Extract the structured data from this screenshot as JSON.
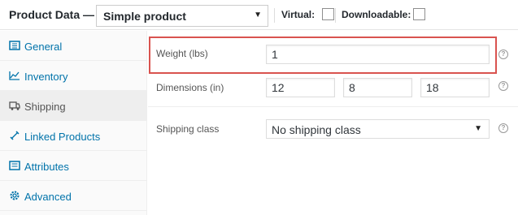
{
  "header": {
    "title": "Product Data —",
    "product_type": "Simple product",
    "virtual_label": "Virtual:",
    "downloadable_label": "Downloadable:"
  },
  "sidebar": {
    "items": [
      {
        "label": "General",
        "icon": "general-grid-icon"
      },
      {
        "label": "Inventory",
        "icon": "inventory-chart-icon"
      },
      {
        "label": "Shipping",
        "icon": "shipping-truck-icon",
        "active": true
      },
      {
        "label": "Linked Products",
        "icon": "link-icon"
      },
      {
        "label": "Attributes",
        "icon": "attributes-list-icon"
      },
      {
        "label": "Advanced",
        "icon": "gear-icon"
      }
    ]
  },
  "shipping": {
    "weight_label": "Weight (lbs)",
    "weight_value": "1",
    "dimensions_label": "Dimensions (in)",
    "length_value": "12",
    "width_value": "8",
    "height_value": "18",
    "class_label": "Shipping class",
    "class_value": "No shipping class",
    "help_glyph": "?"
  },
  "colors": {
    "highlight": "#d9534f",
    "link": "#0073aa"
  }
}
